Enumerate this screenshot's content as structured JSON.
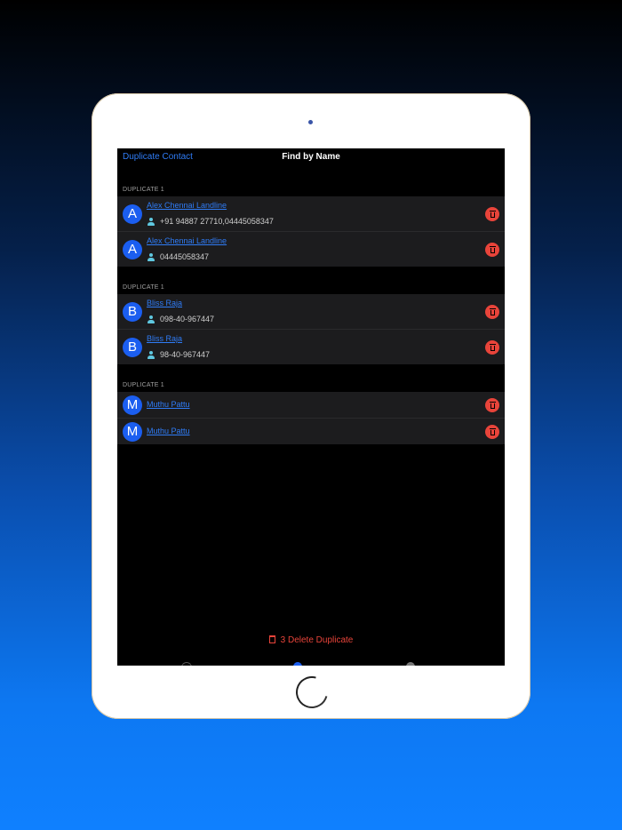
{
  "navbar": {
    "back_label": "Duplicate Contact",
    "title": "Find by Name"
  },
  "sections": [
    {
      "header": "DUPLICATE 1",
      "rows": [
        {
          "initial": "A",
          "name": "Alex Chennai Landline",
          "phone": "+91 94887 27710,04445058347"
        },
        {
          "initial": "A",
          "name": "Alex Chennai Landline",
          "phone": "04445058347"
        }
      ]
    },
    {
      "header": "DUPLICATE 1",
      "rows": [
        {
          "initial": "B",
          "name": "Bliss Raja",
          "phone": "098-40-967447"
        },
        {
          "initial": "B",
          "name": "Bliss Raja",
          "phone": "98-40-967447"
        }
      ]
    },
    {
      "header": "DUPLICATE 1",
      "rows": [
        {
          "initial": "M",
          "name": "Muthu Pattu"
        },
        {
          "initial": "M",
          "name": "Muthu Pattu"
        }
      ]
    }
  ],
  "bottom_action": {
    "label": "3 Delete Duplicate"
  },
  "colors": {
    "accent": "#2f7cf6",
    "danger": "#e8443a",
    "avatar": "#1b5ef0"
  },
  "icons": [
    "person-icon",
    "trash-icon"
  ]
}
